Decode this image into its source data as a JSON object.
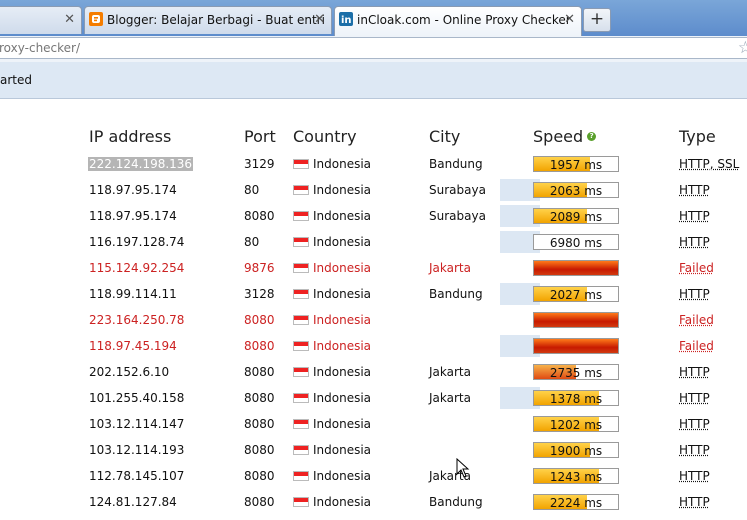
{
  "tabs": [
    {
      "label": "",
      "icon": "page-icon",
      "close": "✕"
    },
    {
      "label": "Blogger: Belajar Berbagi - Buat entri",
      "icon": "blogger-icon",
      "close": "✕"
    },
    {
      "label": "inCloak.com - Online Proxy Checker",
      "icon": "incloak-icon",
      "close": "✕"
    }
  ],
  "newtab_label": "+",
  "url": "roxy-checker/",
  "bookmark_partial": "arted",
  "table": {
    "headers": {
      "ip": "IP address",
      "port": "Port",
      "country": "Country",
      "city": "City",
      "speed": "Speed",
      "type": "Type"
    },
    "rows": [
      {
        "ip": "222.124.198.136",
        "port": "3129",
        "country": "Indonesia",
        "city": "Bandung",
        "speed": "1957 ms",
        "speed_fill": 0.67,
        "type": "HTTP, SSL",
        "failed": false
      },
      {
        "ip": "118.97.95.174",
        "port": "80",
        "country": "Indonesia",
        "city": "Surabaya",
        "speed": "2063 ms",
        "speed_fill": 0.63,
        "type": "HTTP",
        "failed": false
      },
      {
        "ip": "118.97.95.174",
        "port": "8080",
        "country": "Indonesia",
        "city": "Surabaya",
        "speed": "2089 ms",
        "speed_fill": 0.63,
        "type": "HTTP",
        "failed": false
      },
      {
        "ip": "116.197.128.74",
        "port": "80",
        "country": "Indonesia",
        "city": "",
        "speed": "6980 ms",
        "speed_fill": 0.0,
        "type": "HTTP",
        "failed": false
      },
      {
        "ip": "115.124.92.254",
        "port": "9876",
        "country": "Indonesia",
        "city": "Jakarta",
        "speed": "",
        "speed_fill": 1.0,
        "type": "Failed",
        "failed": true
      },
      {
        "ip": "118.99.114.11",
        "port": "3128",
        "country": "Indonesia",
        "city": "Bandung",
        "speed": "2027 ms",
        "speed_fill": 0.63,
        "type": "HTTP",
        "failed": false
      },
      {
        "ip": "223.164.250.78",
        "port": "8080",
        "country": "Indonesia",
        "city": "",
        "speed": "",
        "speed_fill": 1.0,
        "type": "Failed",
        "failed": true
      },
      {
        "ip": "118.97.45.194",
        "port": "8080",
        "country": "Indonesia",
        "city": "",
        "speed": "",
        "speed_fill": 1.0,
        "type": "Failed",
        "failed": true
      },
      {
        "ip": "202.152.6.10",
        "port": "8080",
        "country": "Indonesia",
        "city": "Jakarta",
        "speed": "2735 ms",
        "speed_fill": 0.5,
        "type": "HTTP",
        "failed": false
      },
      {
        "ip": "101.255.40.158",
        "port": "8080",
        "country": "Indonesia",
        "city": "Jakarta",
        "speed": "1378 ms",
        "speed_fill": 0.77,
        "type": "HTTP",
        "failed": false
      },
      {
        "ip": "103.12.114.147",
        "port": "8080",
        "country": "Indonesia",
        "city": "",
        "speed": "1202 ms",
        "speed_fill": 0.77,
        "type": "HTTP",
        "failed": false
      },
      {
        "ip": "103.12.114.193",
        "port": "8080",
        "country": "Indonesia",
        "city": "",
        "speed": "1900 ms",
        "speed_fill": 0.67,
        "type": "HTTP",
        "failed": false
      },
      {
        "ip": "112.78.145.107",
        "port": "8080",
        "country": "Indonesia",
        "city": "Jakarta",
        "speed": "1243 ms",
        "speed_fill": 0.77,
        "type": "HTTP",
        "failed": false
      },
      {
        "ip": "124.81.127.84",
        "port": "8080",
        "country": "Indonesia",
        "city": "Bandung",
        "speed": "2224 ms",
        "speed_fill": 0.63,
        "type": "HTTP",
        "failed": false
      }
    ]
  },
  "colors": {
    "failed": "#cc2222",
    "speed_ok": "#f2a300",
    "speed_fail": "#c71a00",
    "flag_red": "#e22222"
  }
}
